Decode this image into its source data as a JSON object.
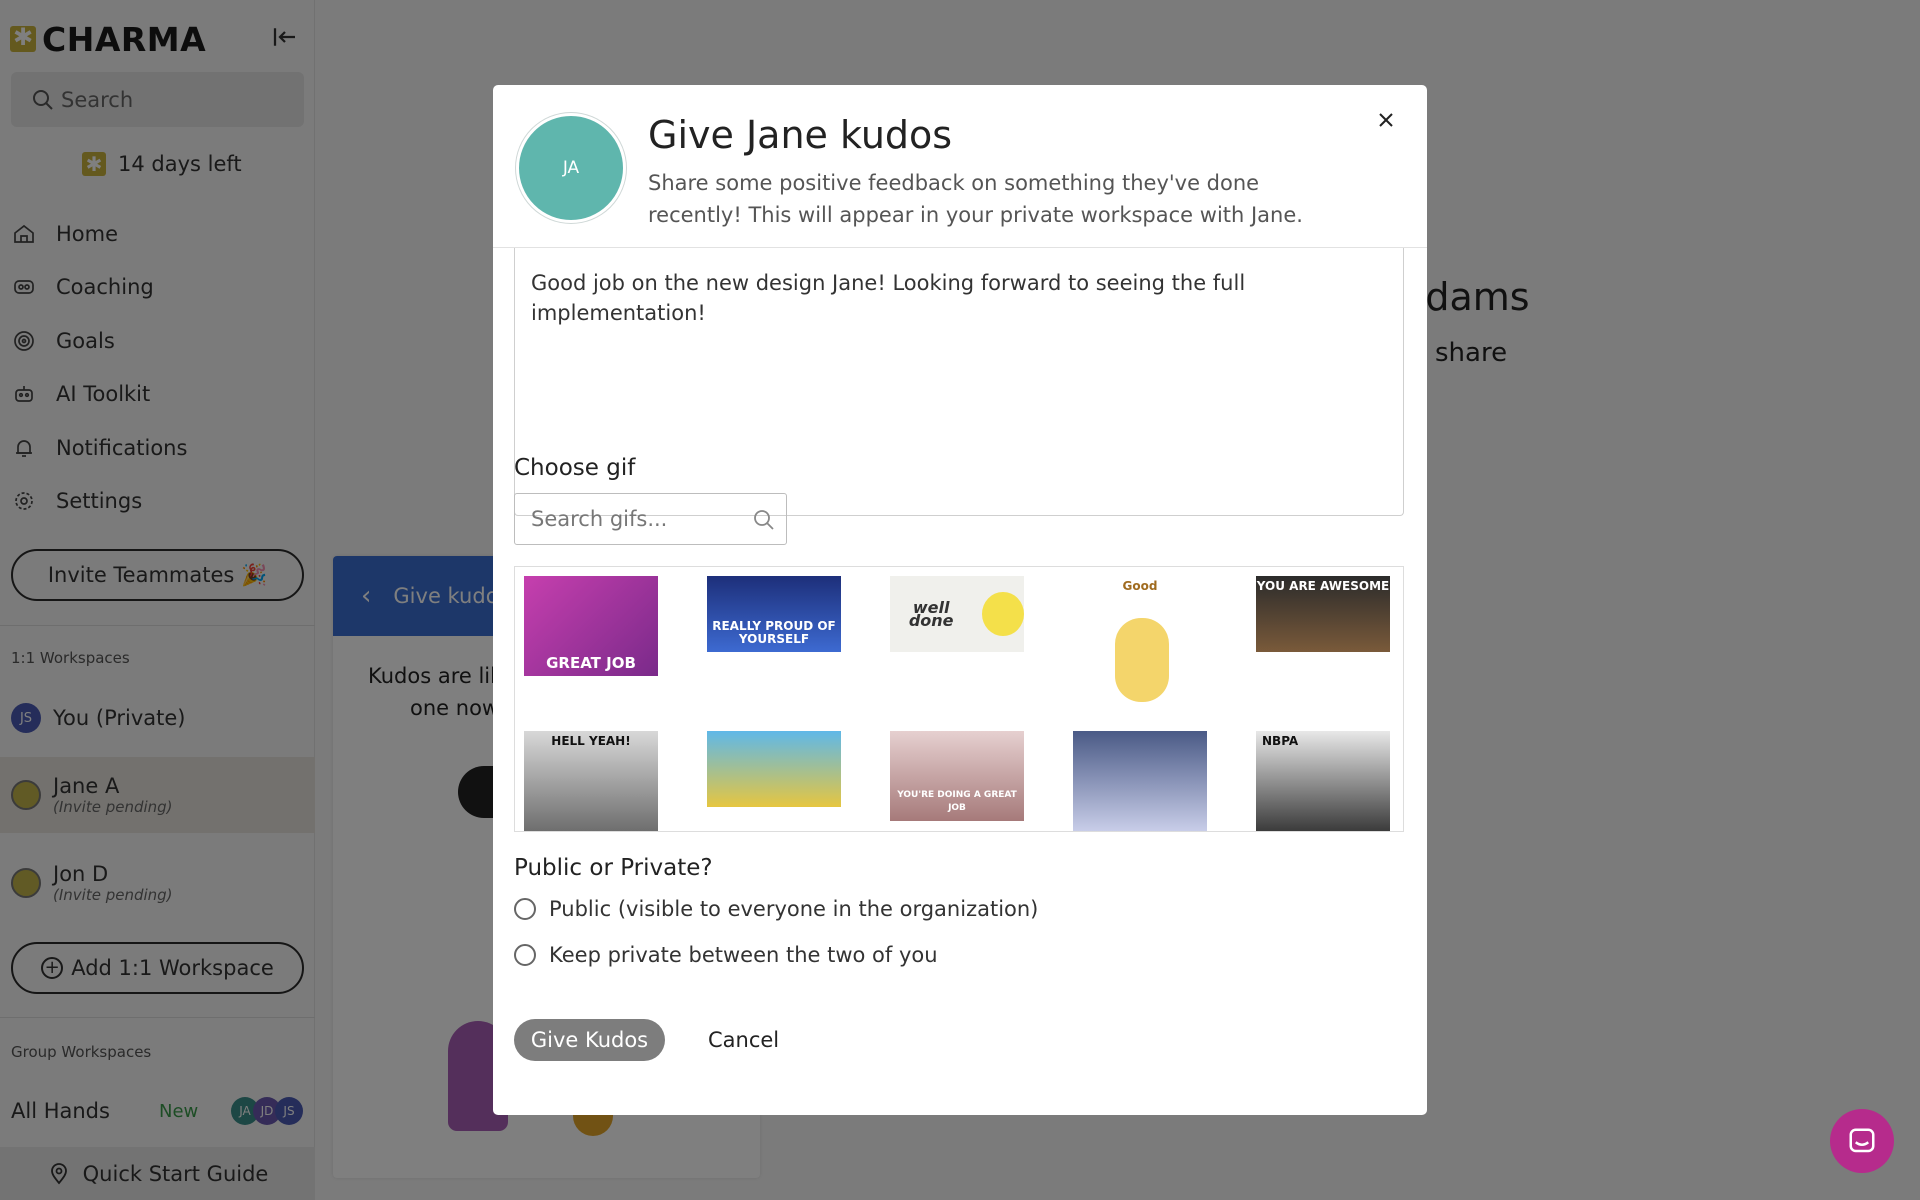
{
  "sidebar": {
    "brand": "CHARMA",
    "search_placeholder": "Search",
    "trial_text": "14 days left",
    "nav": [
      {
        "label": "Home"
      },
      {
        "label": "Coaching"
      },
      {
        "label": "Goals"
      },
      {
        "label": "AI Toolkit"
      },
      {
        "label": "Notifications"
      },
      {
        "label": "Settings"
      }
    ],
    "invite_label": "Invite Teammates 🎉",
    "one_on_one_label": "1:1 Workspaces",
    "workspaces": [
      {
        "initials": "JS",
        "name": "You (Private)",
        "status": ""
      },
      {
        "initials": "",
        "name": "Jane A",
        "status": "(Invite pending)"
      },
      {
        "initials": "",
        "name": "Jon D",
        "status": "(Invite pending)"
      }
    ],
    "add_workspace_label": "Add 1:1 Workspace",
    "group_label": "Group Workspaces",
    "group": {
      "name": "All Hands",
      "badge": "New",
      "avatars": [
        "JA",
        "JD",
        "JS"
      ]
    },
    "quick_start_label": "Quick Start Guide"
  },
  "background": {
    "title_fragment": "Adams",
    "sub_fragment": "share",
    "panel_title": "Give kudo",
    "panel_text_line1": "Kudos are like",
    "panel_text_line2": "one now"
  },
  "modal": {
    "avatar_initials": "JA",
    "title": "Give Jane kudos",
    "description": "Share some positive feedback on something they've done recently! This will appear in your private workspace with Jane.",
    "message": "Good job on the new design Jane! Looking forward to seeing the full implementation!",
    "choose_gif_label": "Choose gif",
    "gif_search_placeholder": "Search gifs...",
    "gifs": [
      {
        "caption": "GREAT JOB"
      },
      {
        "caption": "REALLY PROUD OF YOURSELF"
      },
      {
        "caption": "well done"
      },
      {
        "caption": "Good"
      },
      {
        "caption": "YOU ARE AWESOME"
      },
      {
        "caption": "HELL YEAH!"
      },
      {
        "caption": ""
      },
      {
        "caption": "YOU'RE DOING A GREAT JOB"
      },
      {
        "caption": ""
      },
      {
        "caption": "NBPA"
      }
    ],
    "visibility_label": "Public or Private?",
    "options": [
      {
        "label": "Public (visible to everyone in the organization)"
      },
      {
        "label": "Keep private between the two of you"
      }
    ],
    "submit_label": "Give Kudos",
    "cancel_label": "Cancel"
  },
  "colors": {
    "accent_teal": "#5fb6ad",
    "brand_gold": "#c9b23c",
    "chat_pink": "#b62b8c",
    "panel_blue": "#3b6fd3"
  }
}
